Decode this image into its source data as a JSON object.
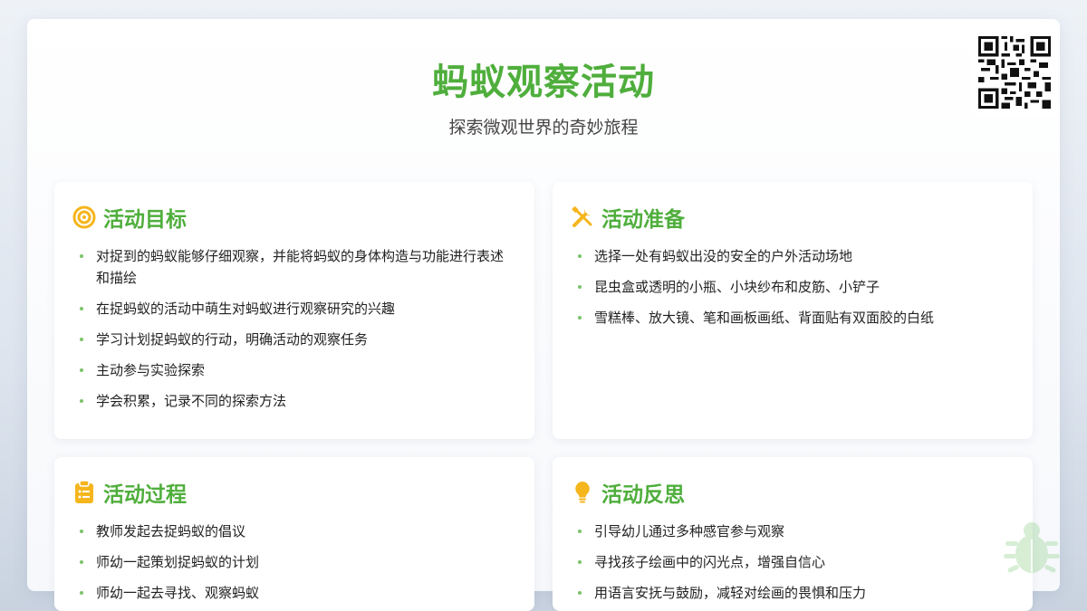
{
  "header": {
    "title": "蚂蚁观察活动",
    "subtitle": "探索微观世界的奇妙旅程"
  },
  "colors": {
    "accent": "#4fae3c",
    "icon": "#f5b51c",
    "bullet": "#7cc36a"
  },
  "cards": [
    {
      "icon": "target-icon",
      "title": "活动目标",
      "items": [
        "对捉到的蚂蚁能够仔细观察，并能将蚂蚁的身体构造与功能进行表述和描绘",
        "在捉蚂蚁的活动中萌生对蚂蚁进行观察研究的兴趣",
        "学习计划捉蚂蚁的行动，明确活动的观察任务",
        "主动参与实验探索",
        "学会积累，记录不同的探索方法"
      ]
    },
    {
      "icon": "tools-icon",
      "title": "活动准备",
      "items": [
        "选择一处有蚂蚁出没的安全的户外活动场地",
        "昆虫盒或透明的小瓶、小块纱布和皮筋、小铲子",
        "雪糕棒、放大镜、笔和画板画纸、背面贴有双面胶的白纸"
      ]
    },
    {
      "icon": "clipboard-icon",
      "title": "活动过程",
      "items": [
        "教师发起去捉蚂蚁的倡议",
        "师幼一起策划捉蚂蚁的计划",
        "师幼一起去寻找、观察蚂蚁"
      ]
    },
    {
      "icon": "lightbulb-icon",
      "title": "活动反思",
      "items": [
        "引导幼儿通过多种感官参与观察",
        "寻找孩子绘画中的闪光点，增强自信心",
        "用语言安抚与鼓励，减轻对绘画的畏惧和压力"
      ]
    }
  ]
}
